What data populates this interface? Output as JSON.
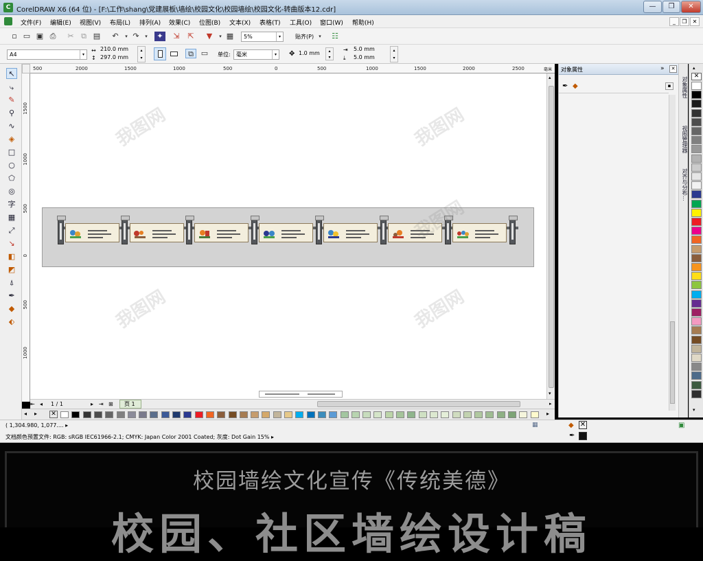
{
  "window": {
    "title": "CorelDRAW X6 (64 位) - [F:\\工作\\shang\\党建展板\\墙绘\\校园文化\\校园墙绘\\校园文化-转曲版本12.cdr]",
    "app_icon_letter": "C",
    "controls": {
      "minimize": "—",
      "maximize": "❐",
      "close": "✕"
    }
  },
  "menu": {
    "items": [
      "文件(F)",
      "编辑(E)",
      "视图(V)",
      "布局(L)",
      "排列(A)",
      "效果(C)",
      "位图(B)",
      "文本(X)",
      "表格(T)",
      "工具(O)",
      "窗口(W)",
      "帮助(H)"
    ],
    "mdi": {
      "minimize": "_",
      "restore": "❐",
      "close": "✕"
    }
  },
  "toolbar1": {
    "icons": [
      "new-icon",
      "open-icon",
      "save-icon",
      "print-icon",
      "cut-icon",
      "copy-icon",
      "paste-icon",
      "undo-icon",
      "redo-icon",
      "import-icon",
      "export-icon",
      "publish-pdf-icon",
      "app-launcher-icon",
      "welcome-icon"
    ],
    "zoom_value": "5%",
    "snap_label": "贴齐(P)"
  },
  "toolbar2": {
    "page_size": "A4",
    "width": "210.0 mm",
    "height": "297.0 mm",
    "units_label": "单位:",
    "units_value": "毫米",
    "nudge": "1.0 mm",
    "dup_x": "5.0 mm",
    "dup_y": "5.0 mm"
  },
  "ruler": {
    "h_ticks": [
      "500",
      "2000",
      "1500",
      "1000",
      "500",
      "0",
      "500",
      "1000",
      "1500",
      "2000",
      "2500"
    ],
    "v_ticks": [
      "1500",
      "1000",
      "500",
      "0",
      "500",
      "1000"
    ],
    "corner": "毫米"
  },
  "docker": {
    "title": "对象属性",
    "tabs": [
      "对象属性",
      "视图管理器",
      "对齐与分布..."
    ]
  },
  "page_nav": {
    "counter": "1 / 1",
    "page_tab": "页 1"
  },
  "status": {
    "coords": "( 1,304.980, 1,077.... ▸",
    "color_profile": "文档颜色预置文件: RGB: sRGB IEC61966-2.1; CMYK: Japan Color 2001 Coated; 灰度: Dot Gain 15% ▸"
  },
  "banner": {
    "subtitle": "校园墙绘文化宣传《传统美德》",
    "main": "校园、社区墙绘设计稿"
  },
  "watermark": "我图网",
  "colors": {
    "palette_vertical": [
      "#ffffff",
      "#000000",
      "#1a1a1a",
      "#333333",
      "#4d4d4d",
      "#666666",
      "#808080",
      "#999999",
      "#b3b3b3",
      "#cccccc",
      "#e6e6e6",
      "#f2f2f2",
      "#2b3990",
      "#00a651",
      "#fff200",
      "#ed1c24",
      "#ec008c",
      "#f26522",
      "#c69c6d",
      "#8b5e3c",
      "#f7941d",
      "#ffde17",
      "#8dc63f",
      "#00aeef",
      "#662d91",
      "#9e1f63",
      "#f49ac1",
      "#a67c52",
      "#754c24",
      "#c2b59b",
      "#e0d9c6",
      "#898989",
      "#4d6b8a",
      "#3c5a40",
      "#2e2e2e"
    ],
    "palette_horizontal": [
      "#ffffff",
      "#000000",
      "#333333",
      "#4d4d4d",
      "#666666",
      "#808080",
      "#8b8b99",
      "#7a7a8c",
      "#5a6e8c",
      "#3b5998",
      "#1f3a6e",
      "#2b3990",
      "#ed1c24",
      "#f26522",
      "#8b5e3c",
      "#754c24",
      "#a67c52",
      "#c69c6d",
      "#d4a86a",
      "#c2b59b",
      "#e6c98a",
      "#00aeef",
      "#0072bc",
      "#3c8dbc",
      "#5b9bd5",
      "#a3c6a0",
      "#b8d4b0",
      "#c7dcbd",
      "#d4e4c8",
      "#bcd4a8",
      "#a5c49a",
      "#8fb58c",
      "#cfe0c3",
      "#dce8d0",
      "#e4eed8",
      "#d0dcc0",
      "#c2d2b0",
      "#b0c8a0",
      "#9fbc92",
      "#8eb084",
      "#7da476",
      "#f5f5dc",
      "#fffacd"
    ],
    "accent": "#2f8a3a"
  }
}
